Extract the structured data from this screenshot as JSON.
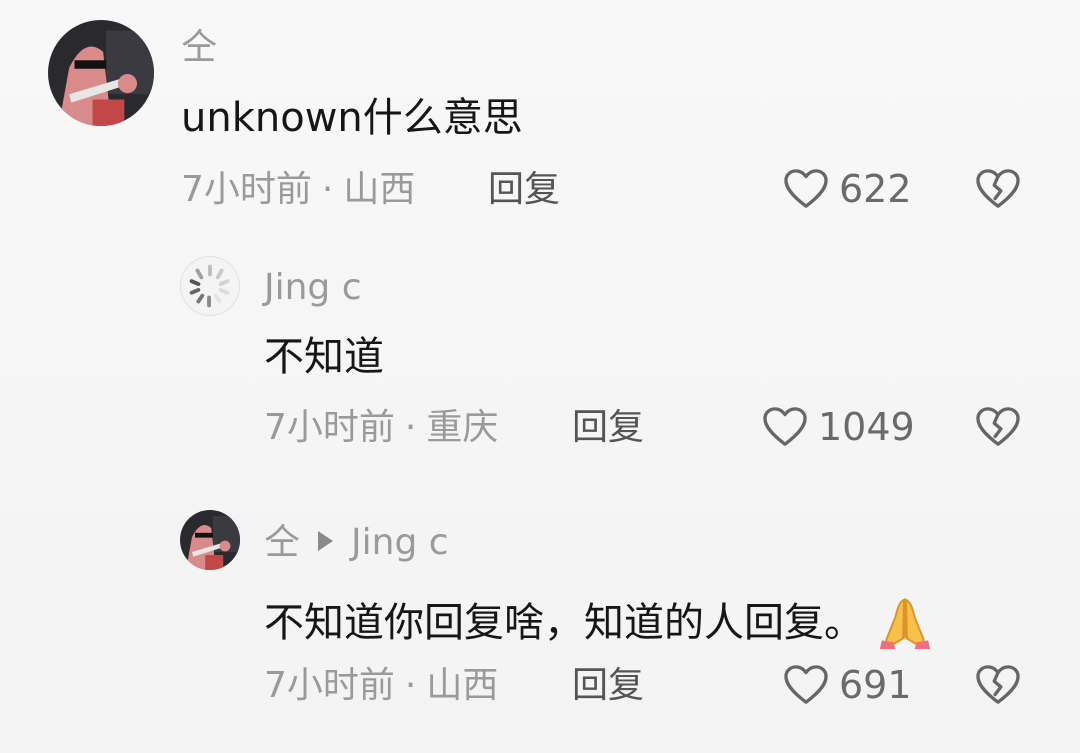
{
  "comments": [
    {
      "username": "仝",
      "text": "unknown什么意思",
      "time": "7小时前",
      "location": "山西",
      "reply_label": "回复",
      "likes": "622"
    },
    {
      "username": "Jing c",
      "text": "不知道",
      "time": "7小时前",
      "location": "重庆",
      "reply_label": "回复",
      "likes": "1049"
    },
    {
      "username": "仝",
      "reply_to": "Jing c",
      "text": "不知道你回复啥，知道的人回复。",
      "emoji": "folded-hands",
      "time": "7小时前",
      "location": "山西",
      "reply_label": "回复",
      "likes": "691"
    }
  ],
  "separator": "·",
  "colors": {
    "meta_gray": "#9a9a9a",
    "text_dark": "#161616",
    "background": "#f8f8f8"
  }
}
